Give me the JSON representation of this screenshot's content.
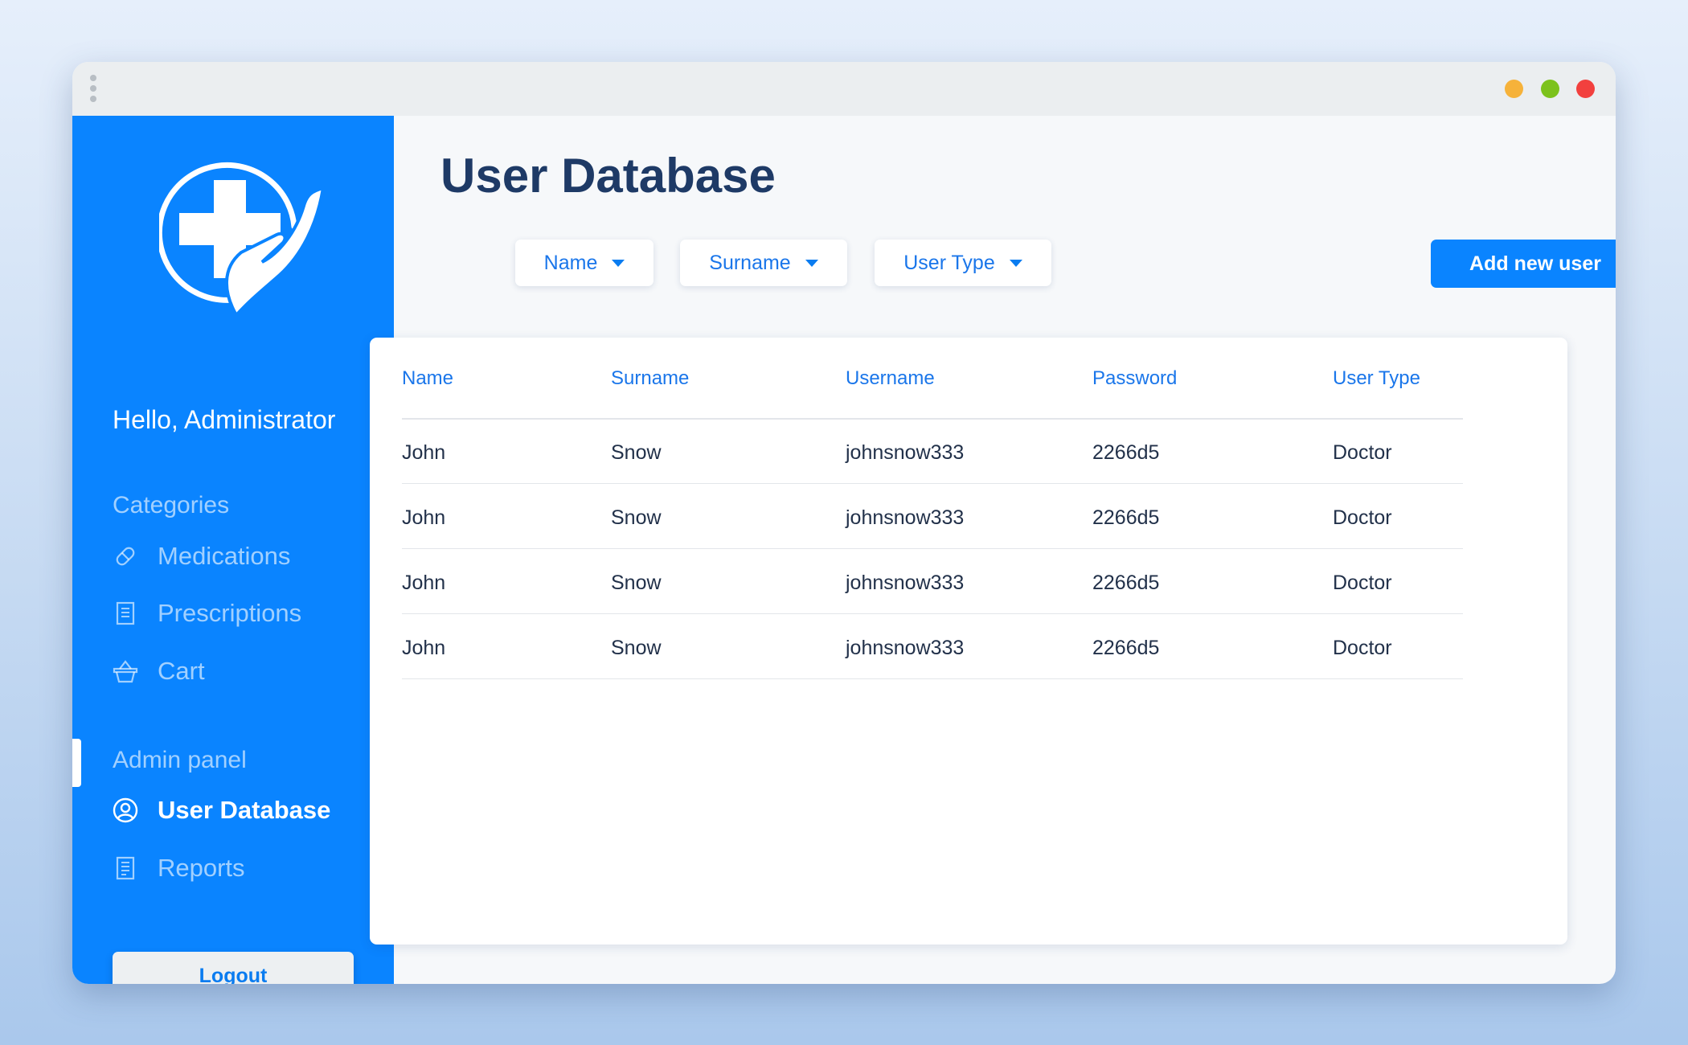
{
  "window": {
    "controls": [
      "minimize",
      "maximize",
      "close"
    ],
    "control_colors": {
      "minimize": "#f6b23a",
      "maximize": "#7cc21c",
      "close": "#f2403e"
    }
  },
  "sidebar": {
    "background": "#0a84ff",
    "logo_icon": "medical-cross-hand-icon",
    "greeting": "Hello, Administrator",
    "categories_label": "Categories",
    "categories": [
      {
        "label": "Medications",
        "icon": "pill-icon"
      },
      {
        "label": "Prescriptions",
        "icon": "document-icon"
      },
      {
        "label": "Cart",
        "icon": "basket-icon"
      }
    ],
    "admin_label": "Admin panel",
    "admin_items": [
      {
        "label": "User Database",
        "icon": "user-circle-icon",
        "active": true
      },
      {
        "label": "Reports",
        "icon": "report-icon",
        "active": false
      }
    ],
    "logout_label": "Logout"
  },
  "main": {
    "title": "User Database",
    "filters": [
      {
        "label": "Name"
      },
      {
        "label": "Surname"
      },
      {
        "label": "User Type"
      }
    ],
    "add_button_label": "Add new user",
    "table": {
      "columns": [
        "Name",
        "Surname",
        "Username",
        "Password",
        "User Type"
      ],
      "rows": [
        [
          "John",
          "Snow",
          "johnsnow333",
          "2266d5",
          "Doctor"
        ],
        [
          "John",
          "Snow",
          "johnsnow333",
          "2266d5",
          "Doctor"
        ],
        [
          "John",
          "Snow",
          "johnsnow333",
          "2266d5",
          "Doctor"
        ],
        [
          "John",
          "Snow",
          "johnsnow333",
          "2266d5",
          "Doctor"
        ]
      ]
    }
  },
  "colors": {
    "accent": "#0a84ff",
    "title_text": "#1e3a66",
    "table_header_text": "#1a76ea",
    "table_cell_text": "#22314a"
  }
}
